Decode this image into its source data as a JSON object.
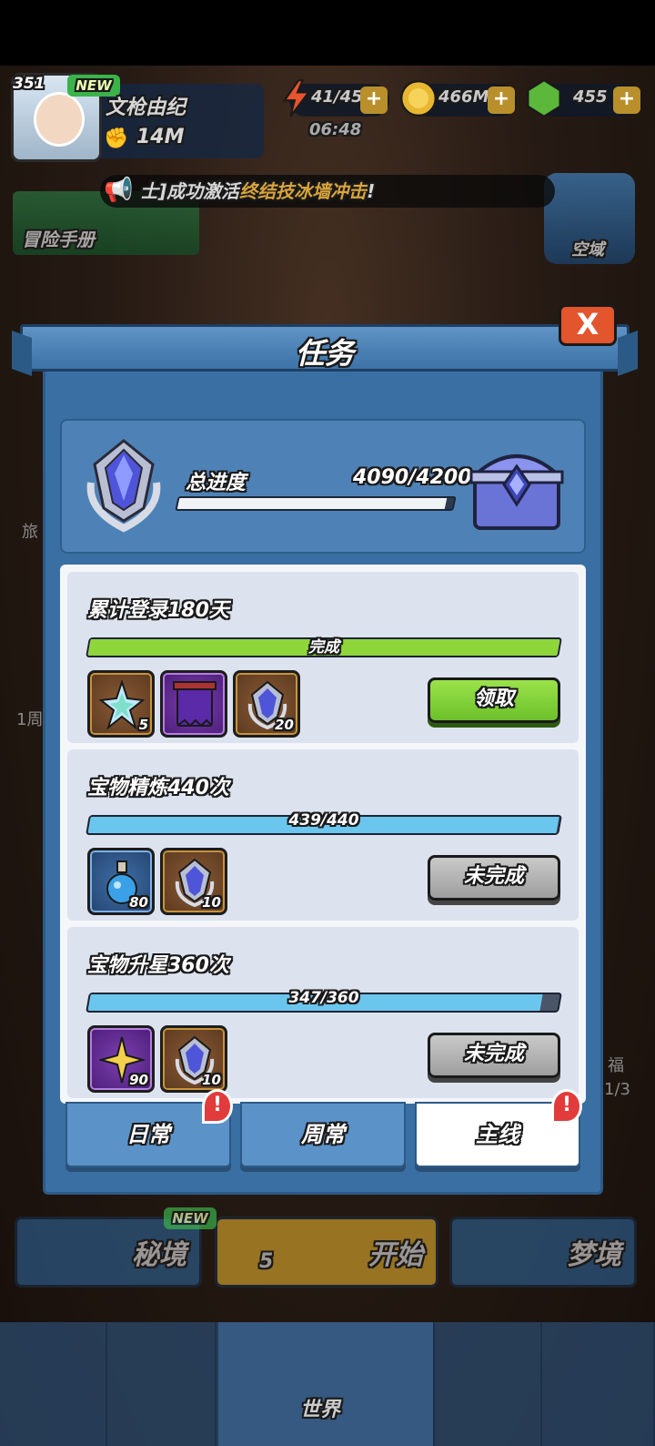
{
  "hud": {
    "level": "351",
    "new_badge": "NEW",
    "player_name": "文枪由纪",
    "power": "14M",
    "stamina": "41/45",
    "stamina_timer": "06:48",
    "gold": "466M",
    "gems": "455",
    "plus": "+"
  },
  "broadcast": {
    "prefix": "士]成功激活",
    "highlight": "终结技冰墙冲击",
    "suffix": "!"
  },
  "background": {
    "adventure_book": "冒险手册",
    "sky_domain": "空域",
    "side_left_1": "旅",
    "side_left_2": "1周",
    "side_right_1": "福",
    "side_right_2": "1/3"
  },
  "modal": {
    "title": "任务",
    "close": "X",
    "total_label": "总进度",
    "total_value": "4090/4200",
    "total_progress": 0.974
  },
  "tasks": [
    {
      "name": "累计登录180天",
      "bar_label": "完成",
      "progress": 1.0,
      "bar_color": "#8fd63a",
      "rewards": [
        {
          "icon": "star-crystal-icon",
          "count": "5",
          "frame": "brown"
        },
        {
          "icon": "purple-banner-icon",
          "count": "",
          "frame": "purple"
        },
        {
          "icon": "crystal-badge-icon",
          "count": "20",
          "frame": "brown"
        }
      ],
      "button": "领取",
      "button_style": "green"
    },
    {
      "name": "宝物精炼440次",
      "bar_label": "439/440",
      "progress": 0.998,
      "bar_color": "#6bc6ee",
      "rewards": [
        {
          "icon": "potion-icon",
          "count": "80",
          "frame": "blue"
        },
        {
          "icon": "crystal-badge-icon",
          "count": "10",
          "frame": "brown"
        }
      ],
      "button": "未完成",
      "button_style": "gray"
    },
    {
      "name": "宝物升星360次",
      "bar_label": "347/360",
      "progress": 0.964,
      "bar_color": "#6bc6ee",
      "rewards": [
        {
          "icon": "gold-star-icon",
          "count": "90",
          "frame": "purple"
        },
        {
          "icon": "crystal-badge-icon",
          "count": "10",
          "frame": "brown"
        }
      ],
      "button": "未完成",
      "button_style": "gray"
    }
  ],
  "tabs": [
    {
      "label": "日常",
      "active": false,
      "alert": true
    },
    {
      "label": "周常",
      "active": false,
      "alert": false
    },
    {
      "label": "主线",
      "active": true,
      "alert": true
    }
  ],
  "bottom": {
    "secret": "秘境",
    "secret_new": "NEW",
    "start": "开始",
    "start_cost": "5",
    "dream": "梦境",
    "world": "世界"
  },
  "colors": {
    "accent_blue": "#3a6fa3",
    "alert_red": "#e23b3b",
    "gold": "#d9a43a"
  }
}
